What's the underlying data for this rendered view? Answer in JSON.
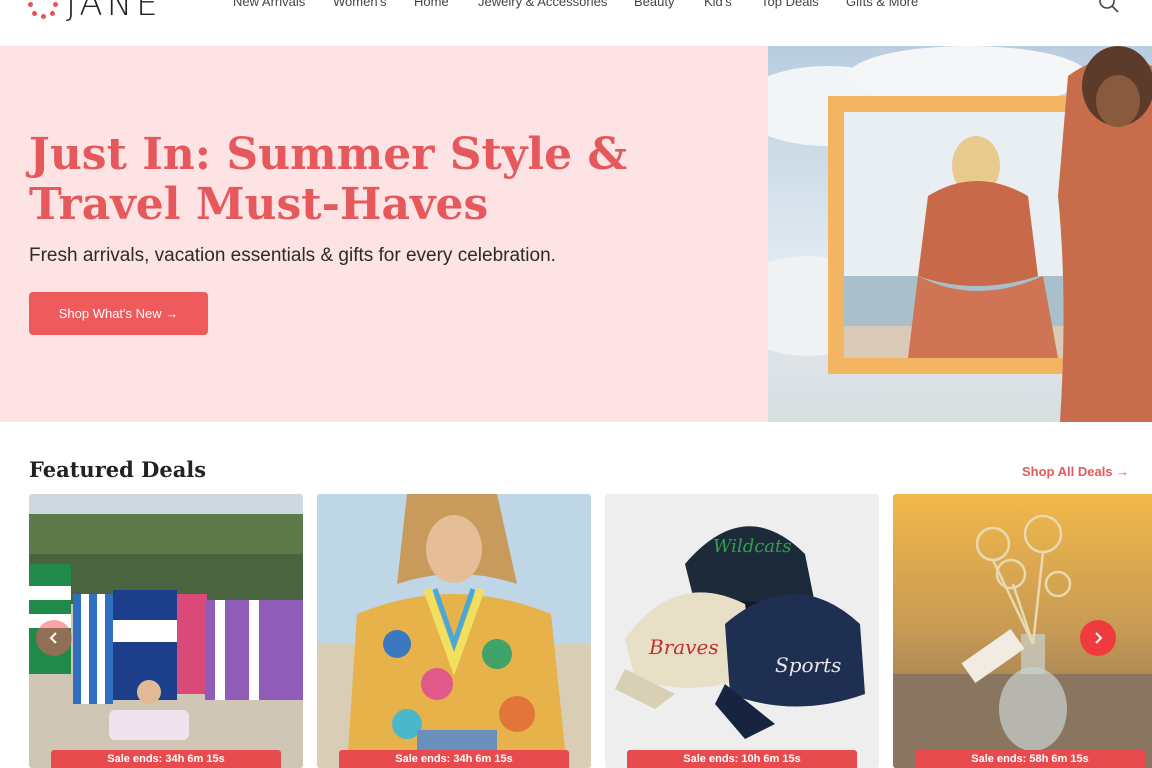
{
  "brand": {
    "name": "JANE",
    "accent": "#e5595c"
  },
  "nav": {
    "items": [
      "New Arrivals",
      "Women's",
      "Home",
      "Jewelry & Accessories",
      "Beauty",
      "Kid's",
      "Top Deals",
      "Gifts & More"
    ],
    "search_icon": "search-icon"
  },
  "hero": {
    "title": "Just In: Summer Style & Travel Must-Haves",
    "subtitle": "Fresh arrivals, vacation essentials & gifts for every celebration.",
    "button_label": "Shop What's New →"
  },
  "featured": {
    "title": "Featured Deals",
    "link": "Shop All Deals →",
    "cards": [
      {
        "badge": "Sale ends: 34h 6m 15s"
      },
      {
        "badge": "Sale ends: 34h 6m 15s"
      },
      {
        "badge": "Sale ends: 10h 6m 15s"
      },
      {
        "badge": "Sale ends: 58h 6m 15s"
      }
    ],
    "prev_icon": "chevron-left-icon",
    "next_icon": "chevron-right-icon"
  }
}
